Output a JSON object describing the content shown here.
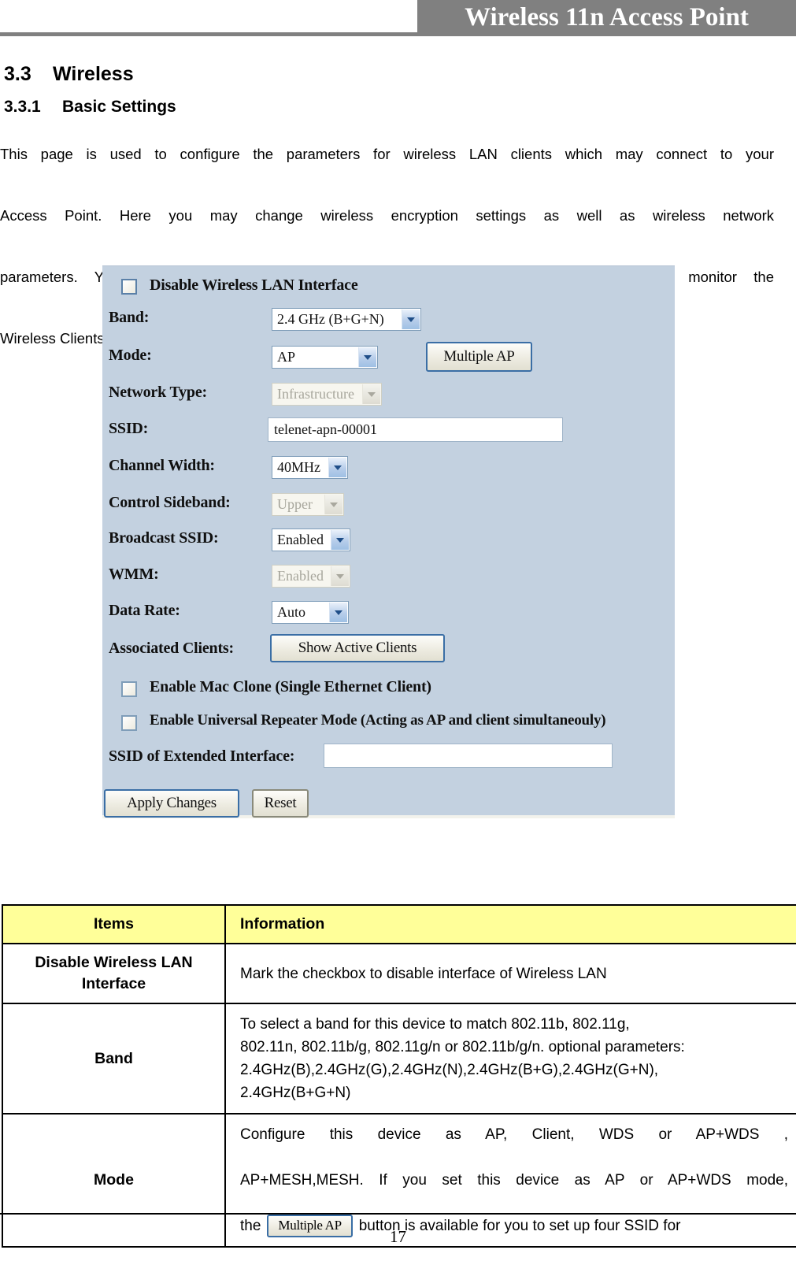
{
  "header": {
    "title": "Wireless 11n Access Point"
  },
  "headings": {
    "section_number": "3.3",
    "section_title": "Wireless",
    "subsection_number": "3.3.1",
    "subsection_title": "Basic Settings"
  },
  "intro": {
    "line1": "This page is used to configure the parameters for wireless LAN clients which may connect to your",
    "line2": "Access Point. Here you may change wireless encryption settings as well as wireless network",
    "line3": "parameters. You can set up the configuration of your Wireless basic settings and monitor the",
    "line4": "Wireless Clients associate with your router."
  },
  "screenshot": {
    "disable_wlan_label": "Disable Wireless LAN Interface",
    "fields": [
      {
        "label": "Band:",
        "value": "2.4 GHz (B+G+N)",
        "control": "select",
        "disabled": false
      },
      {
        "label": "Mode:",
        "value": "AP",
        "control": "select",
        "disabled": false
      },
      {
        "label": "Network Type:",
        "value": "Infrastructure",
        "control": "select",
        "disabled": true
      },
      {
        "label": "SSID:",
        "value": "telenet-apn-00001",
        "control": "text",
        "disabled": false
      },
      {
        "label": "Channel Width:",
        "value": "40MHz",
        "control": "select",
        "disabled": false
      },
      {
        "label": "Control Sideband:",
        "value": "Upper",
        "control": "select",
        "disabled": true
      },
      {
        "label": "Broadcast SSID:",
        "value": "Enabled",
        "control": "select",
        "disabled": false
      },
      {
        "label": "WMM:",
        "value": "Enabled",
        "control": "select",
        "disabled": true
      },
      {
        "label": "Data Rate:",
        "value": "Auto",
        "control": "select",
        "disabled": false
      },
      {
        "label": "Associated Clients:",
        "value": "Show Active Clients",
        "control": "button",
        "disabled": false
      }
    ],
    "multiple_ap_button": "Multiple AP",
    "mac_clone_label": "Enable Mac Clone (Single Ethernet Client)",
    "universal_repeater_label": "Enable Universal Repeater Mode (Acting as AP and client simultaneouly)",
    "ssid_extended_label": "SSID of Extended Interface:",
    "ssid_extended_value": "",
    "apply_button": "Apply Changes",
    "reset_button": "Reset",
    "bg_color": "#c3d1e0"
  },
  "table": {
    "header": {
      "items": "Items",
      "information": "Information"
    },
    "header_bg": "#ffff99",
    "rows": [
      {
        "item": "Disable Wireless LAN Interface",
        "info_lines": [
          "Mark the checkbox to disable interface of Wireless LAN"
        ]
      },
      {
        "item": "Band",
        "info_lines": [
          "To select a band for this device to match 802.11b, 802.11g,",
          "802.11n, 802.11b/g, 802.11g/n or 802.11b/g/n. optional parameters:",
          "2.4GHz(B),2.4GHz(G),2.4GHz(N),2.4GHz(B+G),2.4GHz(G+N),",
          "2.4GHz(B+G+N)"
        ]
      },
      {
        "item": "Mode",
        "info_lines": [
          "Configure this device as AP, Client, WDS or AP+WDS ,",
          "AP+MESH,MESH. If you set this device as AP or AP+WDS mode,"
        ],
        "info_tail_prefix": "the",
        "info_tail_button": "Multiple AP",
        "info_tail_suffix": "button is available for you to set up four SSID for"
      }
    ]
  },
  "footer": {
    "page_number": "17"
  }
}
